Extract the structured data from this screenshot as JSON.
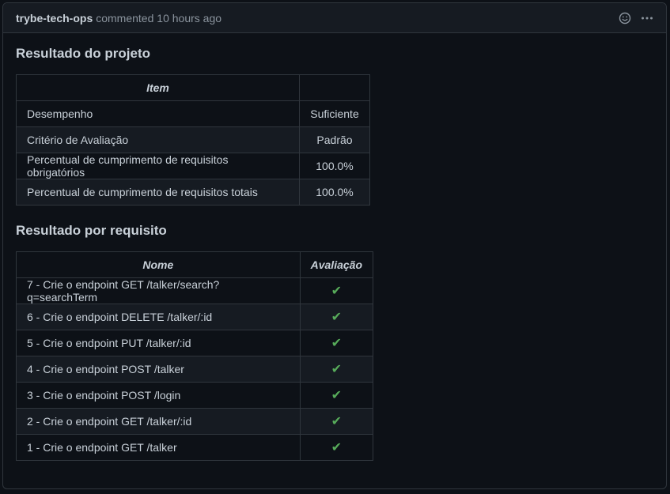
{
  "comment": {
    "author": "trybe-tech-ops",
    "action": "commented",
    "time": "10 hours ago",
    "icons": {
      "reaction": "smiley-icon",
      "menu": "kebab-horizontal-icon"
    }
  },
  "project_result": {
    "heading": "Resultado do projeto",
    "headers": [
      "Item",
      ""
    ],
    "rows": [
      {
        "item": "Desempenho",
        "value": "Suficiente"
      },
      {
        "item": "Critério de Avaliação",
        "value": "Padrão"
      },
      {
        "item": "Percentual de cumprimento de requisitos obrigatórios",
        "value": "100.0%"
      },
      {
        "item": "Percentual de cumprimento de requisitos totais",
        "value": "100.0%"
      }
    ]
  },
  "requirements_result": {
    "heading": "Resultado por requisito",
    "headers": [
      "Nome",
      "Avaliação"
    ],
    "rows": [
      {
        "name": "7 - Crie o endpoint GET /talker/search?q=searchTerm",
        "status": "✔"
      },
      {
        "name": "6 - Crie o endpoint DELETE /talker/:id",
        "status": "✔"
      },
      {
        "name": "5 - Crie o endpoint PUT /talker/:id",
        "status": "✔"
      },
      {
        "name": "4 - Crie o endpoint POST /talker",
        "status": "✔"
      },
      {
        "name": "3 - Crie o endpoint POST /login",
        "status": "✔"
      },
      {
        "name": "2 - Crie o endpoint GET /talker/:id",
        "status": "✔"
      },
      {
        "name": "1 - Crie o endpoint GET /talker",
        "status": "✔"
      }
    ]
  }
}
